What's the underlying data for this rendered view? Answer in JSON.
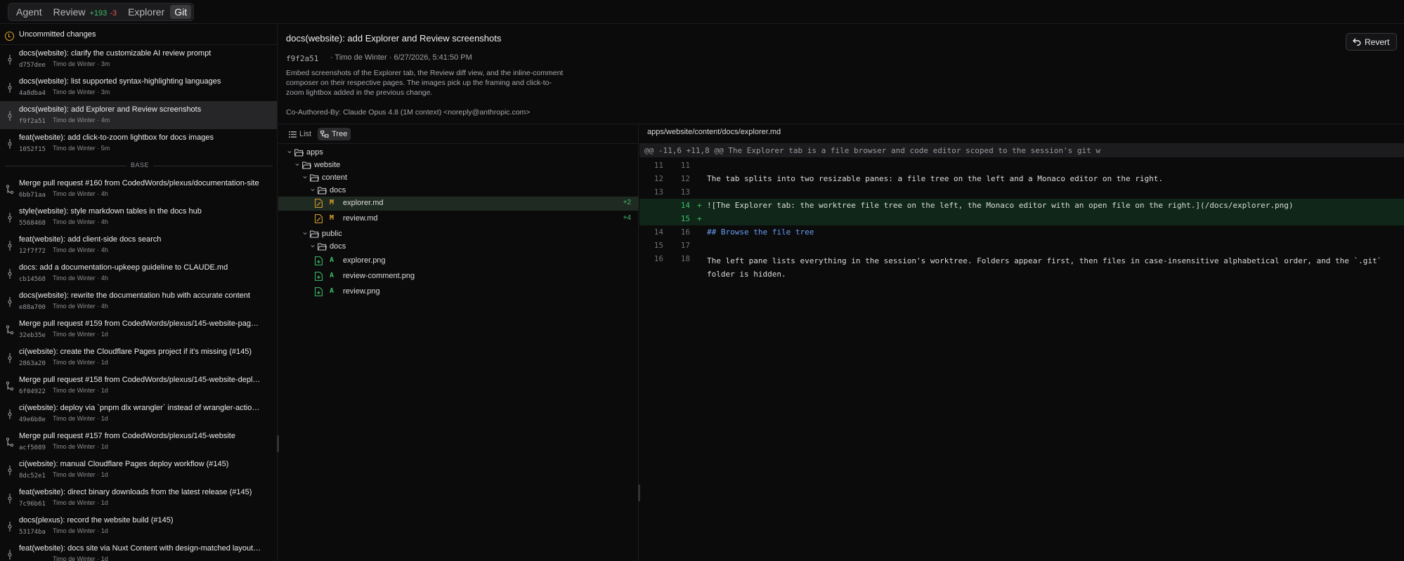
{
  "topbar": {
    "tabs": [
      {
        "label": "Agent"
      },
      {
        "label": "Review",
        "plus": "+193",
        "minus": "-3"
      },
      {
        "label": "Explorer"
      },
      {
        "label": "Git"
      }
    ]
  },
  "sidebar": {
    "uncommitted_label": "Uncommitted changes",
    "base_label": "BASE",
    "commits": [
      {
        "title": "docs(website): clarify the customizable AI review prompt",
        "hash": "d757dee",
        "author": "Timo de Winter",
        "age": "3m"
      },
      {
        "title": "docs(website): list supported syntax-highlighting languages",
        "hash": "4a8dba4",
        "author": "Timo de Winter",
        "age": "3m"
      },
      {
        "title": "docs(website): add Explorer and Review screenshots",
        "hash": "f9f2a51",
        "author": "Timo de Winter",
        "age": "4m"
      },
      {
        "title": "feat(website): add click-to-zoom lightbox for docs images",
        "hash": "1052f15",
        "author": "Timo de Winter",
        "age": "5m"
      },
      {
        "title": "Merge pull request #160 from CodedWords/plexus/documentation-site",
        "hash": "6bb71aa",
        "author": "Timo de Winter",
        "age": "4h"
      },
      {
        "title": "style(website): style markdown tables in the docs hub",
        "hash": "5568468",
        "author": "Timo de Winter",
        "age": "4h"
      },
      {
        "title": "feat(website): add client-side docs search",
        "hash": "12f7f72",
        "author": "Timo de Winter",
        "age": "4h"
      },
      {
        "title": "docs: add a documentation-upkeep guideline to CLAUDE.md",
        "hash": "cb14568",
        "author": "Timo de Winter",
        "age": "4h"
      },
      {
        "title": "docs(website): rewrite the documentation hub with accurate content",
        "hash": "e88a700",
        "author": "Timo de Winter",
        "age": "4h"
      },
      {
        "title": "Merge pull request #159 from CodedWords/plexus/145-website-pag…",
        "hash": "32eb35e",
        "author": "Timo de Winter",
        "age": "1d"
      },
      {
        "title": "ci(website): create the Cloudflare Pages project if it's missing (#145)",
        "hash": "2863a20",
        "author": "Timo de Winter",
        "age": "1d"
      },
      {
        "title": "Merge pull request #158 from CodedWords/plexus/145-website-depl…",
        "hash": "6f04922",
        "author": "Timo de Winter",
        "age": "1d"
      },
      {
        "title": "ci(website): deploy via `pnpm dlx wrangler` instead of wrangler-actio…",
        "hash": "49e6b8e",
        "author": "Timo de Winter",
        "age": "1d"
      },
      {
        "title": "Merge pull request #157 from CodedWords/plexus/145-website",
        "hash": "acf5089",
        "author": "Timo de Winter",
        "age": "1d"
      },
      {
        "title": "ci(website): manual Cloudflare Pages deploy workflow (#145)",
        "hash": "8dc52e1",
        "author": "Timo de Winter",
        "age": "1d"
      },
      {
        "title": "feat(website): direct binary downloads from the latest release (#145)",
        "hash": "7c96b61",
        "author": "Timo de Winter",
        "age": "1d"
      },
      {
        "title": "docs(plexus): record the website build (#145)",
        "hash": "53174ba",
        "author": "Timo de Winter",
        "age": "1d"
      },
      {
        "title": "feat(website): docs site via Nuxt Content with design-matched layout…",
        "hash": "",
        "author": "Timo de Winter",
        "age": "1d"
      }
    ]
  },
  "commit": {
    "title": "docs(website): add Explorer and Review screenshots",
    "hash": "f9f2a51",
    "meta": "· Timo de Winter   · 6/27/2026, 5:41:50 PM",
    "body": "Embed screenshots of the Explorer tab, the Review diff view, and the inline-comment composer on their respective pages. The images pick up the framing and click-to-zoom lightbox added in the previous change.",
    "coauthor": "Co-Authored-By: Claude Opus 4.8 (1M context) <noreply@anthropic.com>",
    "revert_label": "Revert"
  },
  "filetree": {
    "view_list": "List",
    "view_tree": "Tree",
    "nodes": [
      {
        "name": "apps"
      },
      {
        "name": "website"
      },
      {
        "name": "content"
      },
      {
        "name": "docs"
      },
      {
        "name": "explorer.md",
        "status": "M",
        "delta": "+2"
      },
      {
        "name": "review.md",
        "status": "M",
        "delta": "+4"
      },
      {
        "name": "public"
      },
      {
        "name": "docs"
      },
      {
        "name": "explorer.png",
        "status": "A"
      },
      {
        "name": "review-comment.png",
        "status": "A"
      },
      {
        "name": "review.png",
        "status": "A"
      }
    ]
  },
  "diff": {
    "path": "apps/website/content/docs/explorer.md",
    "hunk": "@@ -11,6 +11,8 @@ The Explorer tab is a file browser and code editor scoped to the session's git w",
    "lines": [
      {
        "old": "11",
        "new": "11",
        "mark": "",
        "text": ""
      },
      {
        "old": "12",
        "new": "12",
        "mark": "",
        "text": "The tab splits into two resizable panes: a file tree on the left and a Monaco editor on the right."
      },
      {
        "old": "13",
        "new": "13",
        "mark": "",
        "text": ""
      },
      {
        "old": "",
        "new": "14",
        "mark": "+",
        "text": "![The Explorer tab: the worktree file tree on the left, the Monaco editor with an open file on the right.](/docs/explorer.png)"
      },
      {
        "old": "",
        "new": "15",
        "mark": "+",
        "text": ""
      },
      {
        "old": "14",
        "new": "16",
        "mark": "",
        "text": "## Browse the file tree"
      },
      {
        "old": "15",
        "new": "17",
        "mark": "",
        "text": ""
      },
      {
        "old": "16",
        "new": "18",
        "mark": "",
        "text": "The left pane lists everything in the session's worktree. Folders appear first, then files in case-insensitive alphabetical order, and the `.git` folder is hidden."
      }
    ]
  }
}
